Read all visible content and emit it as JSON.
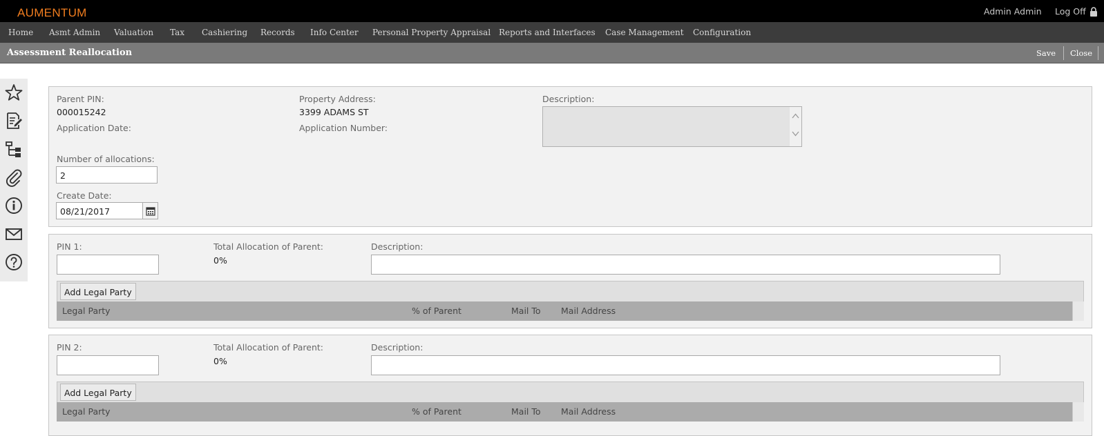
{
  "app": {
    "logo": "AUMENTUM",
    "user": "Admin Admin",
    "logoff": "Log Off"
  },
  "menu": [
    "Home",
    "Asmt Admin",
    "Valuation",
    "Tax",
    "Cashiering",
    "Records",
    "Info Center",
    "Personal Property Appraisal",
    "Reports and Interfaces",
    "Case Management",
    "Configuration"
  ],
  "page": {
    "title": "Assessment Reallocation",
    "save": "Save",
    "close": "Close"
  },
  "sidebar": [
    "star-icon",
    "edit-note-icon",
    "hierarchy-icon",
    "paperclip-icon",
    "info-icon",
    "mail-icon",
    "help-icon"
  ],
  "parent": {
    "pin_label": "Parent PIN:",
    "pin_value": "000015242",
    "address_label": "Property Address:",
    "address_value": "3399 ADAMS ST",
    "description_label": "Description:",
    "app_date_label": "Application Date:",
    "app_number_label": "Application Number:",
    "num_alloc_label": "Number of allocations:",
    "num_alloc_value": "2",
    "create_date_label": "Create Date:",
    "create_date_value": "08/21/2017"
  },
  "allocations": [
    {
      "pin_label": "PIN 1:",
      "pin_value": "",
      "total_label": "Total Allocation of Parent:",
      "total_value": "0%",
      "desc_label": "Description:",
      "desc_value": "",
      "add_btn": "Add Legal Party",
      "columns": [
        "Legal Party",
        "% of Parent",
        "Mail To",
        "Mail Address"
      ]
    },
    {
      "pin_label": "PIN 2:",
      "pin_value": "",
      "total_label": "Total Allocation of Parent:",
      "total_value": "0%",
      "desc_label": "Description:",
      "desc_value": "",
      "add_btn": "Add Legal Party",
      "columns": [
        "Legal Party",
        "% of Parent",
        "Mail To",
        "Mail Address"
      ]
    }
  ],
  "colors": {
    "brand": "#f07d1f",
    "topbar": "#000000",
    "menubar": "#3c3c3c",
    "titlebar": "#7a7a7a"
  }
}
